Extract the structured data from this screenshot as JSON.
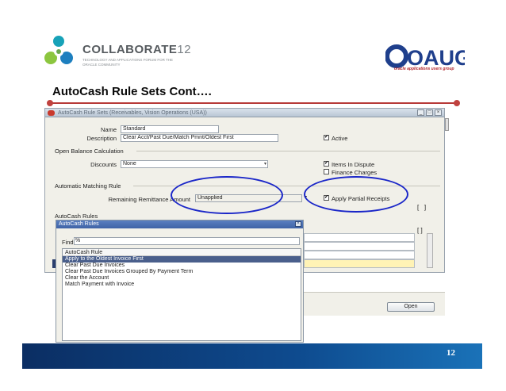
{
  "header": {
    "brand_name": "COLLABORATE",
    "brand_number": "12",
    "brand_tagline": "TECHNOLOGY AND APPLICATIONS FORUM FOR THE ORACLE COMMUNITY",
    "partner_logo_text": "OAUG",
    "partner_subtitle": "oracle applications users group"
  },
  "slide": {
    "title": "AutoCash Rule Sets Cont….",
    "page_number": "12"
  },
  "form": {
    "window_title": "AutoCash Rule Sets (Receivables, Vision Operations (USA))",
    "name_label": "Name",
    "name_value": "Standard",
    "description_label": "Description",
    "description_value": "Clear Acct/Past Due/Match Pmnt/Oldest First",
    "active_label": "Active",
    "open_balance_section": "Open Balance Calculation",
    "discounts_label": "Discounts",
    "discounts_value": "None",
    "items_in_dispute_label": "Items In Dispute",
    "finance_charges_label": "Finance Charges",
    "auto_matching_section": "Automatic Matching Rule",
    "remaining_label": "Remaining Remittance Amount",
    "remaining_value": "Unapplied",
    "apply_partial_label": "Apply Partial Receipts",
    "autocash_rules_section": "AutoCash Rules",
    "open_button": "Open",
    "active_checked": true,
    "items_in_dispute_checked": true,
    "finance_charges_checked": false,
    "apply_partial_checked": true
  },
  "lov": {
    "title": "AutoCash Rules",
    "find_label": "Find",
    "find_value": "%",
    "column_header": "AutoCash Rule",
    "items": [
      "Apply to the Oldest Invoice First",
      "Clear Past Due Invoices",
      "Clear Past Due Invoices Grouped By Payment Term",
      "Clear the Account",
      "Match Payment with Invoice"
    ],
    "selected_index": 0
  },
  "colors": {
    "accent_red": "#b73a38",
    "highlight_blue": "#1a26c8",
    "footer_navy": "#0b2e63",
    "lov_selected": "#4a5f8c",
    "brand_teal": "#17a2b8",
    "brand_green": "#8cc63f"
  },
  "icons": {
    "close": "close-icon",
    "checkbox_checked": "checkmark-icon",
    "dropdown": "chevron-down-icon"
  }
}
